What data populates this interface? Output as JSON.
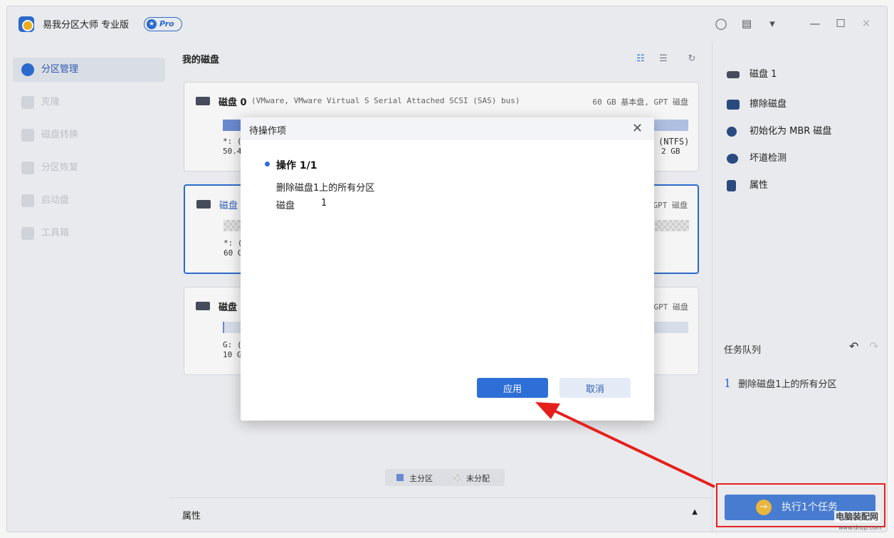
{
  "app": {
    "title": "易我分区大师  专业版",
    "badge": "Pro"
  },
  "sidebar": {
    "items": [
      {
        "label": "分区管理",
        "icon": "pie-chart-icon",
        "active": true
      },
      {
        "label": "克隆",
        "icon": "clone-icon",
        "active": false
      },
      {
        "label": "磁盘转换",
        "icon": "disk-convert-icon",
        "active": false
      },
      {
        "label": "分区恢复",
        "icon": "partition-recovery-icon",
        "active": false
      },
      {
        "label": "启动盘",
        "icon": "boot-disk-icon",
        "active": false
      },
      {
        "label": "工具箱",
        "icon": "toolbox-icon",
        "active": false
      }
    ]
  },
  "main": {
    "title": "我的磁盘",
    "disks": [
      {
        "name": "磁盘 0",
        "desc": "(VMware,  VMware Virtual S Serial Attached SCSI (SAS) bus)",
        "meta": "60 GB 基本盘, GPT 磁盘",
        "left_label": "*: (",
        "left_size": "50.4",
        "right_label": "(NTFS)",
        "right_size": "2 GB"
      },
      {
        "name": "磁盘",
        "meta": "GPT 磁盘",
        "left_label": "*: (",
        "left_size": "60 G"
      },
      {
        "name": "磁盘",
        "meta": "GPT 磁盘",
        "left_label": "G: (",
        "left_size": "10 G"
      }
    ],
    "legend": {
      "primary": "主分区",
      "unallocated": "未分配"
    },
    "properties": "属性"
  },
  "right": {
    "items": [
      {
        "label": "磁盘 1",
        "icon": "disk-icon"
      },
      {
        "label": "擦除磁盘",
        "icon": "eraser-icon"
      },
      {
        "label": "初始化为 MBR 磁盘",
        "icon": "initialize-icon"
      },
      {
        "label": "坏道检测",
        "icon": "surface-test-icon"
      },
      {
        "label": "属性",
        "icon": "properties-icon"
      }
    ],
    "queue_title": "任务队列",
    "queue": [
      {
        "num": "1",
        "label": "删除磁盘1上的所有分区"
      }
    ],
    "execute": "执行1个任务"
  },
  "dialog": {
    "title": "待操作项",
    "op_title": "操作 1/1",
    "op_desc": "删除磁盘1上的所有分区",
    "op_disk_label": "磁盘",
    "op_disk_value": "1",
    "apply": "应用",
    "cancel": "取消"
  },
  "watermark": {
    "text": "电脑装配网",
    "url": "www.dnzp.com"
  },
  "colors": {
    "accent": "#2d6fd6",
    "annotation": "#e5201c",
    "execute_icon": "#f5b51e"
  }
}
